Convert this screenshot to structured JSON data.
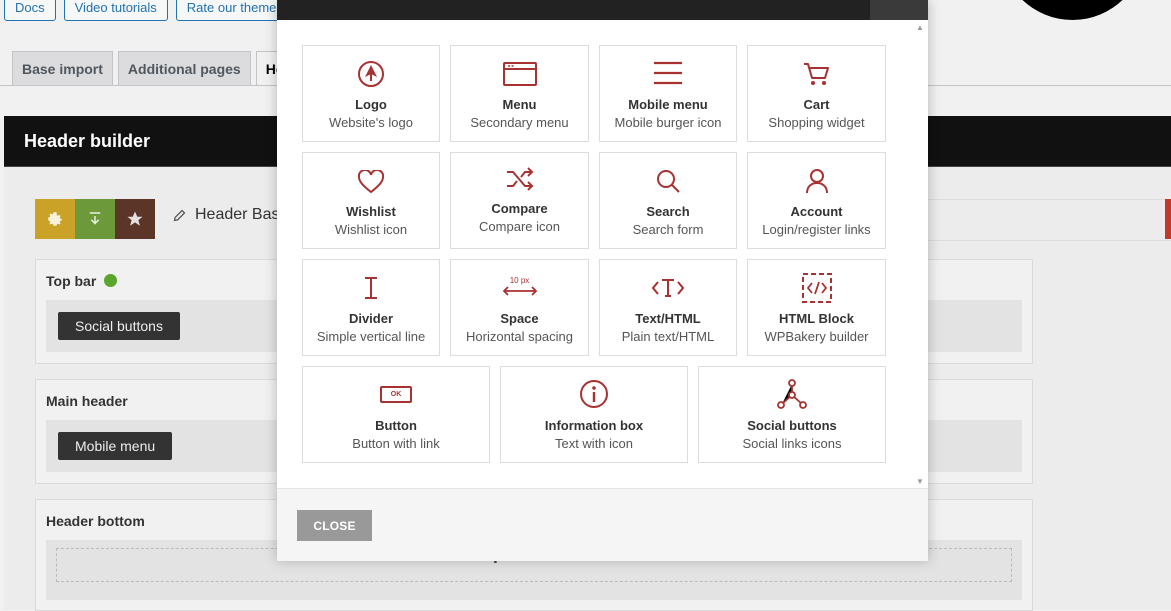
{
  "top_links": [
    "Docs",
    "Video tutorials",
    "Rate our theme"
  ],
  "tabs": [
    {
      "label": "Base import"
    },
    {
      "label": "Additional pages"
    },
    {
      "label": "He"
    }
  ],
  "header_builder": {
    "title": "Header builder",
    "preset_name": "Header Bas"
  },
  "sections": {
    "top_bar": {
      "title": "Top bar",
      "item": "Social buttons"
    },
    "main_header": {
      "title": "Main header",
      "item": "Mobile menu"
    },
    "header_bottom": {
      "title": "Header bottom",
      "add": "+"
    }
  },
  "modal": {
    "elements": [
      {
        "title": "Logo",
        "subtitle": "Website's logo",
        "icon": "logo-icon"
      },
      {
        "title": "Menu",
        "subtitle": "Secondary menu",
        "icon": "menu-window-icon"
      },
      {
        "title": "Mobile menu",
        "subtitle": "Mobile burger icon",
        "icon": "burger-icon"
      },
      {
        "title": "Cart",
        "subtitle": "Shopping widget",
        "icon": "cart-icon"
      },
      {
        "title": "Wishlist",
        "subtitle": "Wishlist icon",
        "icon": "heart-icon"
      },
      {
        "title": "Compare",
        "subtitle": "Compare icon",
        "icon": "shuffle-icon"
      },
      {
        "title": "Search",
        "subtitle": "Search form",
        "icon": "search-icon"
      },
      {
        "title": "Account",
        "subtitle": "Login/register links",
        "icon": "user-icon"
      },
      {
        "title": "Divider",
        "subtitle": "Simple vertical line",
        "icon": "divider-icon"
      },
      {
        "title": "Space",
        "subtitle": "Horizontal spacing",
        "icon": "space-icon",
        "icon_label": "10 px"
      },
      {
        "title": "Text/HTML",
        "subtitle": "Plain text/HTML",
        "icon": "text-html-icon"
      },
      {
        "title": "HTML Block",
        "subtitle": "WPBakery builder",
        "icon": "html-block-icon"
      },
      {
        "title": "Button",
        "subtitle": "Button with link",
        "icon": "button-icon",
        "icon_label": "OK"
      },
      {
        "title": "Information box",
        "subtitle": "Text with icon",
        "icon": "info-icon"
      },
      {
        "title": "Social buttons",
        "subtitle": "Social links icons",
        "icon": "share-icon"
      }
    ],
    "close_label": "CLOSE"
  },
  "colors": {
    "accent": "#a83232",
    "close_button": "#999999",
    "header_bar": "#111111"
  }
}
